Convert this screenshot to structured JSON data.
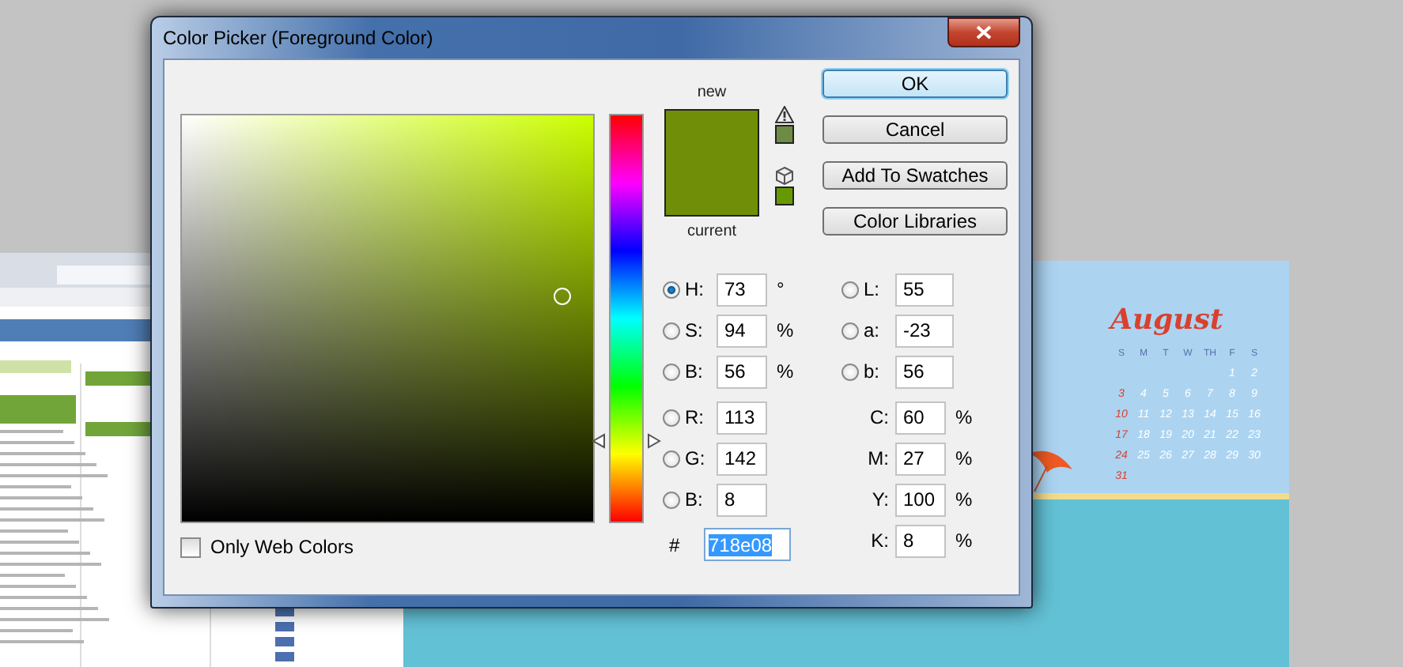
{
  "window": {
    "title": "Color Picker (Foreground Color)"
  },
  "hue_slider": {
    "level": 0.2
  },
  "preview": {
    "new_label": "new",
    "current_label": "current"
  },
  "gamut_alerts": [
    {
      "kind": "out-of-gamut",
      "color": "#6e8b43"
    },
    {
      "kind": "web-safe",
      "color": "#669900"
    }
  ],
  "buttons": [
    {
      "label": "OK",
      "default": true
    },
    {
      "label": "Cancel",
      "default": false
    },
    {
      "label": "Add To Swatches",
      "default": false
    },
    {
      "label": "Color Libraries",
      "default": false
    }
  ],
  "left_fields": [
    {
      "label": "H:",
      "value": "73",
      "unit": "°",
      "selected": true
    },
    {
      "label": "S:",
      "value": "94",
      "unit": "%",
      "selected": false
    },
    {
      "label": "B:",
      "value": "56",
      "unit": "%",
      "selected": false
    },
    {
      "label": "R:",
      "value": "113",
      "selected": false
    },
    {
      "label": "G:",
      "value": "142",
      "selected": false
    },
    {
      "label": "B:",
      "value": "8",
      "selected": false
    }
  ],
  "right_fields": [
    {
      "kind": "radio",
      "label": "L:",
      "value": "55",
      "selected": false
    },
    {
      "kind": "radio",
      "label": "a:",
      "value": "-23",
      "selected": false
    },
    {
      "kind": "radio",
      "label": "b:",
      "value": "56",
      "selected": false
    },
    {
      "kind": "plain",
      "label": "C:",
      "value": "60",
      "unit": "%"
    },
    {
      "kind": "plain",
      "label": "M:",
      "value": "27",
      "unit": "%"
    },
    {
      "kind": "plain",
      "label": "Y:",
      "value": "100",
      "unit": "%"
    },
    {
      "kind": "plain",
      "label": "K:",
      "value": "8",
      "unit": "%"
    }
  ],
  "hex_field": {
    "label": "#",
    "value": "718e08",
    "highlighted": true
  },
  "only_web_colors": {
    "label": "Only Web Colors",
    "checked": false
  },
  "calendar": {
    "month": "August",
    "weekdays": [
      "S",
      "M",
      "T",
      "W",
      "TH",
      "F",
      "S"
    ],
    "weeks": [
      [
        "1",
        "2"
      ],
      [
        "3",
        "4",
        "5",
        "6",
        "7",
        "8",
        "9"
      ],
      [
        "10",
        "11",
        "12",
        "13",
        "14",
        "15",
        "16"
      ],
      [
        "17",
        "18",
        "19",
        "20",
        "21",
        "22",
        "23"
      ],
      [
        "24",
        "25",
        "26",
        "27",
        "28",
        "29",
        "30"
      ],
      [
        "31"
      ]
    ]
  }
}
